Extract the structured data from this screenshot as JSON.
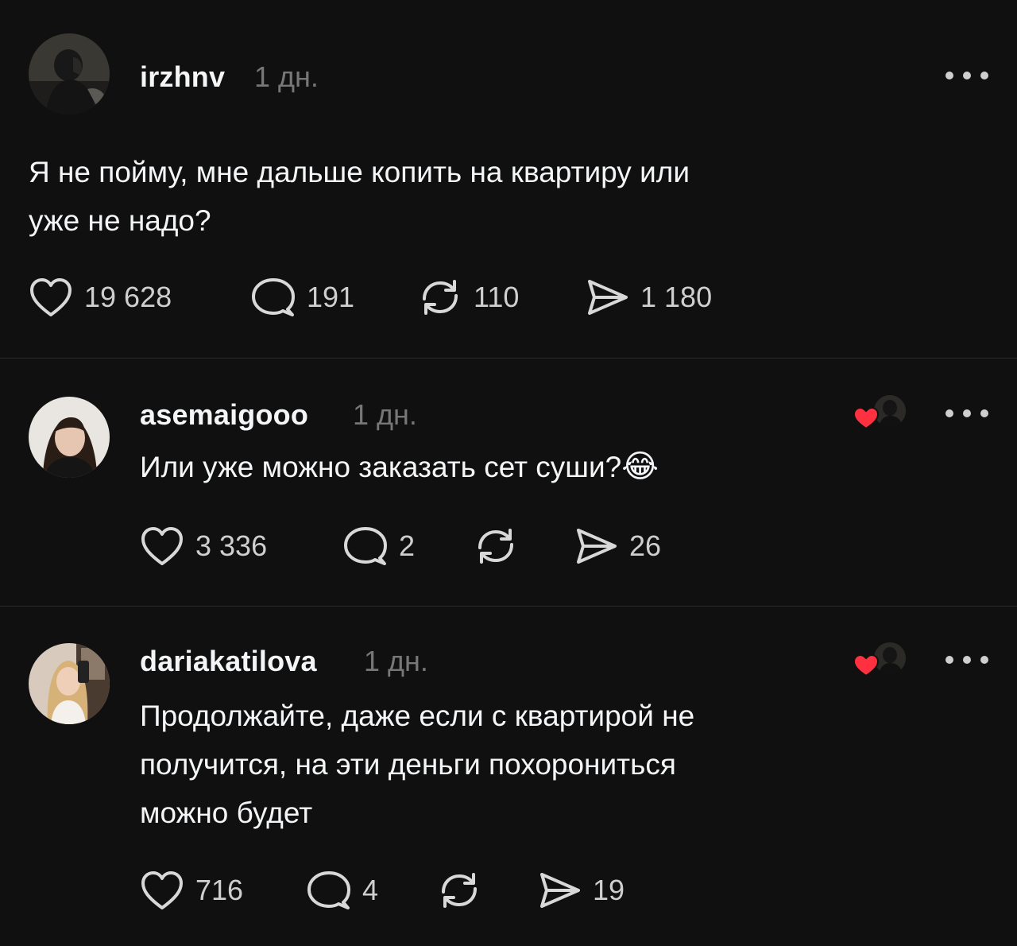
{
  "posts": [
    {
      "username": "irzhnv",
      "time": "1 дн.",
      "text_lines": [
        "Я не пойму, мне дальше копить на квартиру или",
        "уже не надо?"
      ],
      "likes": "19 628",
      "comments": "191",
      "reposts": "110",
      "shares": "1 180"
    },
    {
      "username": "asemaigooo",
      "time": "1 дн.",
      "text_lines": [
        "Или уже можно заказать сет суши?"
      ],
      "emoji": "😂",
      "likes": "3 336",
      "comments": "2",
      "reposts": "",
      "shares": "26"
    },
    {
      "username": "dariakatilova",
      "time": "1 дн.",
      "text_lines": [
        "Продолжайте, даже если с квартирой не",
        "получится, на эти деньги похорониться",
        "можно будет"
      ],
      "likes": "716",
      "comments": "4",
      "reposts": "",
      "shares": "19"
    }
  ],
  "icons": {
    "like": "heart-icon",
    "comment": "comment-bubble-icon",
    "repost": "repost-arrows-icon",
    "share": "send-icon",
    "more": "more-dots-icon",
    "liked_by_author": "liked-by-author-heart-icon"
  },
  "colors": {
    "background": "#101010",
    "text": "#f3f5f7",
    "secondary": "#777777",
    "heart_red": "#ff3040"
  }
}
